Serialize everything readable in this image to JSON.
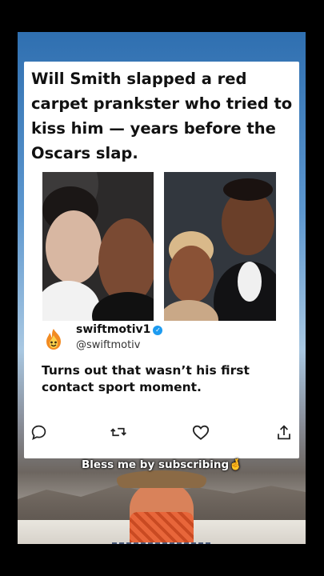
{
  "post": {
    "headline": "Will Smith slapped a red carpet prankster who tried to kiss him — years before the Oscars slap.",
    "photos": [
      {
        "name": "photo-left",
        "icon": "prankster-kiss-photo"
      },
      {
        "name": "photo-right",
        "icon": "couple-red-carpet-photo"
      }
    ]
  },
  "tweet": {
    "display_name": "swiftmotiv1",
    "username": "@swiftmotiv",
    "verified": true,
    "text": "Turns out that wasn’t his first contact sport moment.",
    "avatar_icon": "fire-emoji-icon",
    "actions": [
      "reply-icon",
      "retweet-icon",
      "like-icon",
      "share-icon"
    ]
  },
  "caption": {
    "text": "Bless me by subscribing🤞"
  },
  "colors": {
    "verified": "#1d9bf0",
    "text": "#111111",
    "card": "#ffffff"
  }
}
